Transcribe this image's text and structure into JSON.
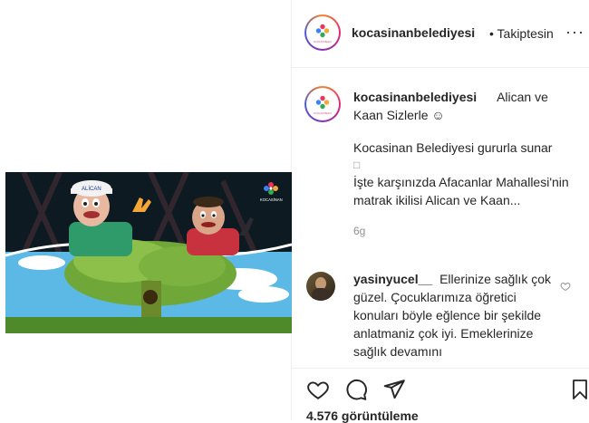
{
  "post": {
    "username": "kocasinanbelediyesi",
    "follow_label": "• Takiptesin",
    "more_label": "···",
    "avatar_brand": "KOCASİNAN",
    "video_brand": "KOCASİNAN",
    "caption_inline": "Alican ve Kaan Sizlerle ☺",
    "caption_body_1": "Kocasinan Belediyesi gururla sunar",
    "caption_glyph": "□",
    "caption_body_2": "İşte karşınızda Afacanlar Mahallesi'nin matrak ikilisi Alican ve Kaan...",
    "time_ago": "6g",
    "puppet_cap_text": "ALİCAN"
  },
  "comments": [
    {
      "username": "yasinyucel__",
      "text": "Ellerinize sağlık çok güzel. Çocuklarımıza öğretici konuları böyle eğlence bir şekilde anlatmaniz çok iyi. Emeklerinize sağlık devamını"
    }
  ],
  "footer": {
    "views": "4.576 görüntüleme"
  },
  "icons": {
    "like": "heart-icon",
    "comment": "comment-icon",
    "share": "send-icon",
    "save": "bookmark-icon",
    "comment_like": "heart-icon"
  },
  "colors": {
    "text": "#262626",
    "muted": "#8e8e8e",
    "border": "#efefef",
    "sky": "#58b8e8",
    "tree": "#7fb43a"
  }
}
